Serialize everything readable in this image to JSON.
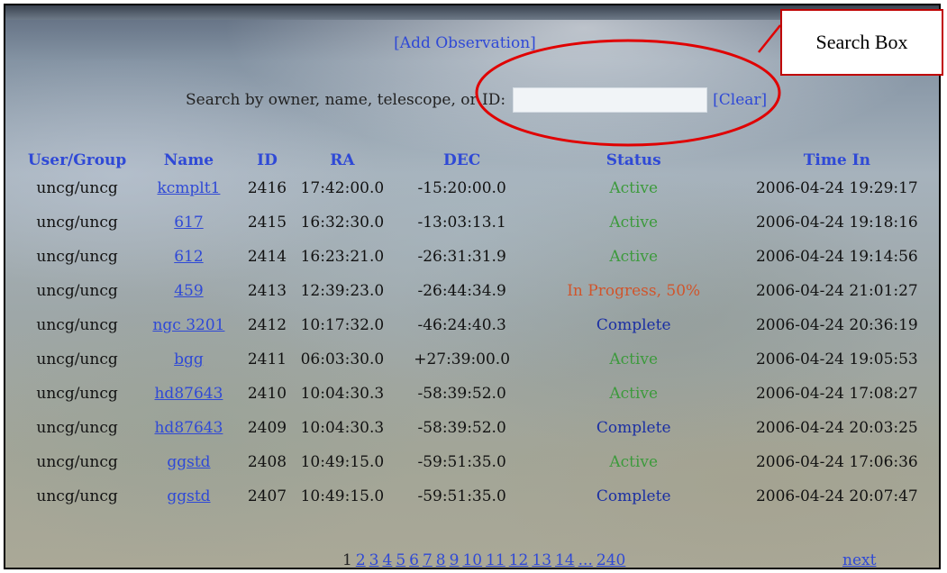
{
  "header": {
    "add_observation": "[Add Observation]"
  },
  "search": {
    "label": "Search by owner, name, telescope, or ID:",
    "value": "",
    "clear_label": "[Clear]"
  },
  "table": {
    "columns": [
      "User/Group",
      "Name",
      "ID",
      "RA",
      "DEC",
      "Status",
      "Time In"
    ],
    "rows": [
      {
        "user": "uncg/uncg",
        "name": "kcmplt1",
        "id": "2416",
        "ra": "17:42:00.0",
        "dec": "-15:20:00.0",
        "status": "Active",
        "status_kind": "active",
        "time": "2006-04-24 19:29:17"
      },
      {
        "user": "uncg/uncg",
        "name": "617",
        "id": "2415",
        "ra": "16:32:30.0",
        "dec": "-13:03:13.1",
        "status": "Active",
        "status_kind": "active",
        "time": "2006-04-24 19:18:16"
      },
      {
        "user": "uncg/uncg",
        "name": "612",
        "id": "2414",
        "ra": "16:23:21.0",
        "dec": "-26:31:31.9",
        "status": "Active",
        "status_kind": "active",
        "time": "2006-04-24 19:14:56"
      },
      {
        "user": "uncg/uncg",
        "name": "459",
        "id": "2413",
        "ra": "12:39:23.0",
        "dec": "-26:44:34.9",
        "status": "In Progress, 50%",
        "status_kind": "progress",
        "time": "2006-04-24 21:01:27"
      },
      {
        "user": "uncg/uncg",
        "name": "ngc 3201",
        "id": "2412",
        "ra": "10:17:32.0",
        "dec": "-46:24:40.3",
        "status": "Complete",
        "status_kind": "complete",
        "time": "2006-04-24 20:36:19"
      },
      {
        "user": "uncg/uncg",
        "name": "bgg",
        "id": "2411",
        "ra": "06:03:30.0",
        "dec": "+27:39:00.0",
        "status": "Active",
        "status_kind": "active",
        "time": "2006-04-24 19:05:53"
      },
      {
        "user": "uncg/uncg",
        "name": "hd87643",
        "id": "2410",
        "ra": "10:04:30.3",
        "dec": "-58:39:52.0",
        "status": "Active",
        "status_kind": "active",
        "time": "2006-04-24 17:08:27"
      },
      {
        "user": "uncg/uncg",
        "name": "hd87643",
        "id": "2409",
        "ra": "10:04:30.3",
        "dec": "-58:39:52.0",
        "status": "Complete",
        "status_kind": "complete",
        "time": "2006-04-24 20:03:25"
      },
      {
        "user": "uncg/uncg",
        "name": "ggstd",
        "id": "2408",
        "ra": "10:49:15.0",
        "dec": "-59:51:35.0",
        "status": "Active",
        "status_kind": "active",
        "time": "2006-04-24 17:06:36"
      },
      {
        "user": "uncg/uncg",
        "name": "ggstd",
        "id": "2407",
        "ra": "10:49:15.0",
        "dec": "-59:51:35.0",
        "status": "Complete",
        "status_kind": "complete",
        "time": "2006-04-24 20:07:47"
      }
    ]
  },
  "pagination": {
    "current": "1",
    "pages": [
      "2",
      "3",
      "4",
      "5",
      "6",
      "7",
      "8",
      "9",
      "10",
      "11",
      "12",
      "13",
      "14"
    ],
    "ellipsis": "...",
    "last": "240",
    "next_label": "next"
  },
  "annotation": {
    "callout_label": "Search Box",
    "color": "#e00000"
  },
  "colors": {
    "link": "#2f49d6",
    "status_active": "#3c9a3c",
    "status_progress": "#d0552c",
    "status_complete": "#1a2ea3"
  }
}
